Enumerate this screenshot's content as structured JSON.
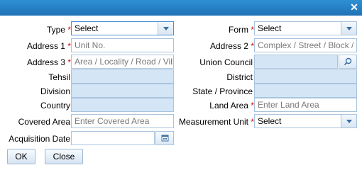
{
  "dialog": {
    "close_icon": "close-icon"
  },
  "form": {
    "type": {
      "label": "Type",
      "required": "*",
      "value": "Select"
    },
    "form": {
      "label": "Form",
      "required": "*",
      "value": "Select"
    },
    "address1": {
      "label": "Address 1",
      "required": "*",
      "placeholder": "Unit No."
    },
    "address2": {
      "label": "Address 2",
      "required": "*",
      "placeholder": "Complex / Street / Block / S"
    },
    "address3": {
      "label": "Address 3",
      "required": "*",
      "placeholder": "Area / Locality / Road / Villa"
    },
    "union_council": {
      "label": "Union Council"
    },
    "tehsil": {
      "label": "Tehsil"
    },
    "district": {
      "label": "District"
    },
    "division": {
      "label": "Division"
    },
    "state_province": {
      "label": "State / Province"
    },
    "country": {
      "label": "Country"
    },
    "land_area": {
      "label": "Land Area",
      "required": "*",
      "placeholder": "Enter Land Area"
    },
    "covered_area": {
      "label": "Covered Area",
      "placeholder": "Enter Covered Area"
    },
    "measurement_unit": {
      "label": "Measurement Unit",
      "required": "*",
      "value": "Select"
    },
    "acquisition_date": {
      "label": "Acquisition Date"
    }
  },
  "buttons": {
    "ok": "OK",
    "close": "Close"
  },
  "colors": {
    "title_bar": "#1f73b6",
    "required": "#d40000",
    "readonly_fill": "#d4e5f6"
  }
}
